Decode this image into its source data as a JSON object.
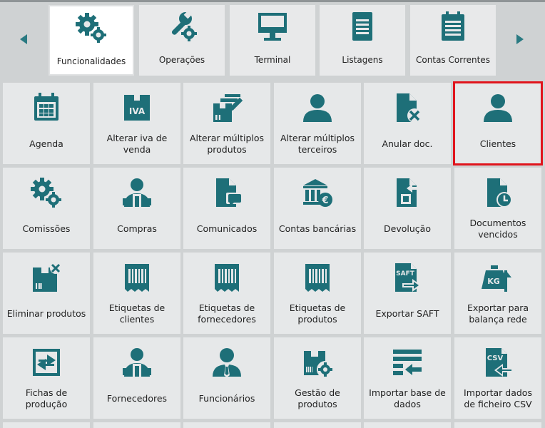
{
  "tabs": [
    {
      "label": "Funcionalidades",
      "icon": "gears-icon",
      "active": true
    },
    {
      "label": "Operações",
      "icon": "wrench-gear-icon",
      "active": false
    },
    {
      "label": "Terminal",
      "icon": "monitor-icon",
      "active": false
    },
    {
      "label": "Listagens",
      "icon": "document-list-icon",
      "active": false
    },
    {
      "label": "Contas Correntes",
      "icon": "clipboard-list-icon",
      "active": false
    }
  ],
  "tiles": [
    {
      "label": "Agenda",
      "icon": "calendar-icon"
    },
    {
      "label": "Alterar iva de venda",
      "icon": "vat-box-icon",
      "icon_text": "IVA"
    },
    {
      "label": "Alterar múltiplos produtos",
      "icon": "boxes-edit-icon"
    },
    {
      "label": "Alterar múltiplos terceiros",
      "icon": "person-icon"
    },
    {
      "label": "Anular doc.",
      "icon": "document-cancel-icon"
    },
    {
      "label": "Clientes",
      "icon": "person-icon",
      "selected": true
    },
    {
      "label": "Comissões",
      "icon": "gears-icon"
    },
    {
      "label": "Compras",
      "icon": "person-cart-icon"
    },
    {
      "label": "Comunicados",
      "icon": "document-chat-icon"
    },
    {
      "label": "Contas bancárias",
      "icon": "bank-euro-icon"
    },
    {
      "label": "Devolução",
      "icon": "document-return-icon"
    },
    {
      "label": "Documentos vencidos",
      "icon": "document-clock-icon"
    },
    {
      "label": "Eliminar produtos",
      "icon": "box-delete-icon"
    },
    {
      "label": "Etiquetas de clientes",
      "icon": "barcode-label-icon"
    },
    {
      "label": "Etiquetas de fornecedores",
      "icon": "barcode-label-icon"
    },
    {
      "label": "Etiquetas de produtos",
      "icon": "barcode-label-icon"
    },
    {
      "label": "Exportar SAFT",
      "icon": "saft-export-icon",
      "icon_text": "SAFT"
    },
    {
      "label": "Exportar para balança rede",
      "icon": "scale-export-icon",
      "icon_text": "KG"
    },
    {
      "label": "Fichas de produção",
      "icon": "production-sheet-icon"
    },
    {
      "label": "Fornecedores",
      "icon": "person-cart-icon"
    },
    {
      "label": "Funcionários",
      "icon": "person-tie-icon"
    },
    {
      "label": "Gestão de produtos",
      "icon": "box-gear-icon"
    },
    {
      "label": "Importar base de dados",
      "icon": "list-import-icon"
    },
    {
      "label": "Importar dados de ficheiro CSV",
      "icon": "csv-import-icon",
      "icon_text": "CSV"
    }
  ],
  "colors": {
    "accent": "#1e6f78",
    "selection": "#e0141c"
  }
}
